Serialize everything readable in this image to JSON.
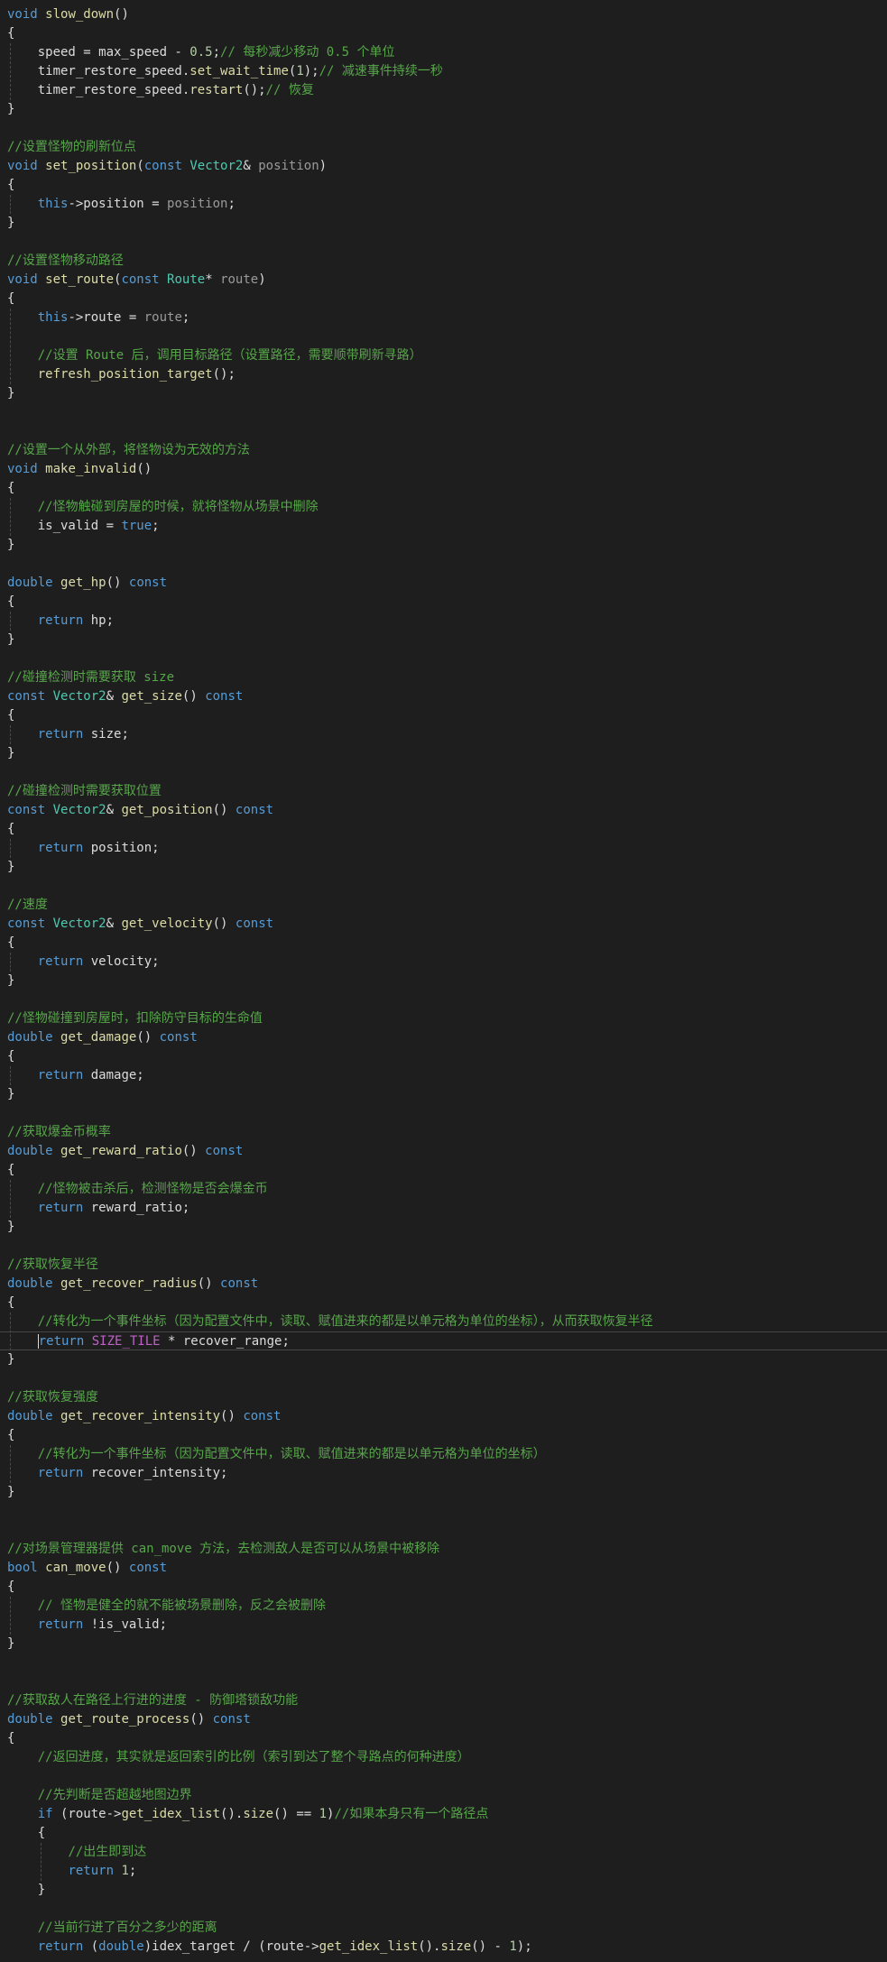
{
  "colors": {
    "background": "#1e1e1e",
    "plain": "#dcdcdc",
    "keyword": "#569cd6",
    "type": "#4ec9b0",
    "function": "#dcdcaa",
    "comment": "#57a64a",
    "number": "#b5cea8",
    "macro": "#bd63c5",
    "parameter": "#9a9a9a"
  },
  "code_lines": [
    [
      [
        "kw",
        "void"
      ],
      [
        "pl",
        " "
      ],
      [
        "fn",
        "slow_down"
      ],
      [
        "pl",
        "()"
      ]
    ],
    [
      [
        "pl",
        "{"
      ]
    ],
    [
      [
        "pl",
        "    speed = max_speed - "
      ],
      [
        "num",
        "0.5"
      ],
      [
        "pl",
        ";"
      ],
      [
        "cm",
        "// 每秒减少移动 0.5 个单位"
      ]
    ],
    [
      [
        "pl",
        "    timer_restore_speed."
      ],
      [
        "fn",
        "set_wait_time"
      ],
      [
        "pl",
        "("
      ],
      [
        "num",
        "1"
      ],
      [
        "pl",
        ");"
      ],
      [
        "cm",
        "// 减速事件持续一秒"
      ]
    ],
    [
      [
        "pl",
        "    timer_restore_speed."
      ],
      [
        "fn",
        "restart"
      ],
      [
        "pl",
        "();"
      ],
      [
        "cm",
        "// 恢复"
      ]
    ],
    [
      [
        "pl",
        "}"
      ]
    ],
    [],
    [
      [
        "cm",
        "//设置怪物的刷新位点"
      ]
    ],
    [
      [
        "kw",
        "void"
      ],
      [
        "pl",
        " "
      ],
      [
        "fn",
        "set_position"
      ],
      [
        "pl",
        "("
      ],
      [
        "kw",
        "const"
      ],
      [
        "pl",
        " "
      ],
      [
        "ty",
        "Vector2"
      ],
      [
        "pl",
        "& "
      ],
      [
        "par",
        "position"
      ],
      [
        "pl",
        ")"
      ]
    ],
    [
      [
        "pl",
        "{"
      ]
    ],
    [
      [
        "pl",
        "    "
      ],
      [
        "kw",
        "this"
      ],
      [
        "pl",
        "->position = "
      ],
      [
        "par",
        "position"
      ],
      [
        "pl",
        ";"
      ]
    ],
    [
      [
        "pl",
        "}"
      ]
    ],
    [],
    [
      [
        "cm",
        "//设置怪物移动路径"
      ]
    ],
    [
      [
        "kw",
        "void"
      ],
      [
        "pl",
        " "
      ],
      [
        "fn",
        "set_route"
      ],
      [
        "pl",
        "("
      ],
      [
        "kw",
        "const"
      ],
      [
        "pl",
        " "
      ],
      [
        "ty",
        "Route"
      ],
      [
        "pl",
        "* "
      ],
      [
        "par",
        "route"
      ],
      [
        "pl",
        ")"
      ]
    ],
    [
      [
        "pl",
        "{"
      ]
    ],
    [
      [
        "pl",
        "    "
      ],
      [
        "kw",
        "this"
      ],
      [
        "pl",
        "->route = "
      ],
      [
        "par",
        "route"
      ],
      [
        "pl",
        ";"
      ]
    ],
    [],
    [
      [
        "pl",
        "    "
      ],
      [
        "cm",
        "//设置 Route 后，调用目标路径（设置路径，需要顺带刷新寻路）"
      ]
    ],
    [
      [
        "pl",
        "    "
      ],
      [
        "fn",
        "refresh_position_target"
      ],
      [
        "pl",
        "();"
      ]
    ],
    [
      [
        "pl",
        "}"
      ]
    ],
    [],
    [],
    [
      [
        "cm",
        "//设置一个从外部，将怪物设为无效的方法"
      ]
    ],
    [
      [
        "kw",
        "void"
      ],
      [
        "pl",
        " "
      ],
      [
        "fn",
        "make_invalid"
      ],
      [
        "pl",
        "()"
      ]
    ],
    [
      [
        "pl",
        "{"
      ]
    ],
    [
      [
        "pl",
        "    "
      ],
      [
        "cm",
        "//怪物触碰到房屋的时候，就将怪物从场景中删除"
      ]
    ],
    [
      [
        "pl",
        "    is_valid = "
      ],
      [
        "kw",
        "true"
      ],
      [
        "pl",
        ";"
      ]
    ],
    [
      [
        "pl",
        "}"
      ]
    ],
    [],
    [
      [
        "kw",
        "double"
      ],
      [
        "pl",
        " "
      ],
      [
        "fn",
        "get_hp"
      ],
      [
        "pl",
        "() "
      ],
      [
        "kw",
        "const"
      ]
    ],
    [
      [
        "pl",
        "{"
      ]
    ],
    [
      [
        "pl",
        "    "
      ],
      [
        "kw",
        "return"
      ],
      [
        "pl",
        " hp;"
      ]
    ],
    [
      [
        "pl",
        "}"
      ]
    ],
    [],
    [
      [
        "cm",
        "//碰撞检测时需要获取 size"
      ]
    ],
    [
      [
        "kw",
        "const"
      ],
      [
        "pl",
        " "
      ],
      [
        "ty",
        "Vector2"
      ],
      [
        "pl",
        "& "
      ],
      [
        "fn",
        "get_size"
      ],
      [
        "pl",
        "() "
      ],
      [
        "kw",
        "const"
      ]
    ],
    [
      [
        "pl",
        "{"
      ]
    ],
    [
      [
        "pl",
        "    "
      ],
      [
        "kw",
        "return"
      ],
      [
        "pl",
        " size;"
      ]
    ],
    [
      [
        "pl",
        "}"
      ]
    ],
    [],
    [
      [
        "cm",
        "//碰撞检测时需要获取位置"
      ]
    ],
    [
      [
        "kw",
        "const"
      ],
      [
        "pl",
        " "
      ],
      [
        "ty",
        "Vector2"
      ],
      [
        "pl",
        "& "
      ],
      [
        "fn",
        "get_position"
      ],
      [
        "pl",
        "() "
      ],
      [
        "kw",
        "const"
      ]
    ],
    [
      [
        "pl",
        "{"
      ]
    ],
    [
      [
        "pl",
        "    "
      ],
      [
        "kw",
        "return"
      ],
      [
        "pl",
        " position;"
      ]
    ],
    [
      [
        "pl",
        "}"
      ]
    ],
    [],
    [
      [
        "cm",
        "//速度"
      ]
    ],
    [
      [
        "kw",
        "const"
      ],
      [
        "pl",
        " "
      ],
      [
        "ty",
        "Vector2"
      ],
      [
        "pl",
        "& "
      ],
      [
        "fn",
        "get_velocity"
      ],
      [
        "pl",
        "() "
      ],
      [
        "kw",
        "const"
      ]
    ],
    [
      [
        "pl",
        "{"
      ]
    ],
    [
      [
        "pl",
        "    "
      ],
      [
        "kw",
        "return"
      ],
      [
        "pl",
        " velocity;"
      ]
    ],
    [
      [
        "pl",
        "}"
      ]
    ],
    [],
    [
      [
        "cm",
        "//怪物碰撞到房屋时，扣除防守目标的生命值"
      ]
    ],
    [
      [
        "kw",
        "double"
      ],
      [
        "pl",
        " "
      ],
      [
        "fn",
        "get_damage"
      ],
      [
        "pl",
        "() "
      ],
      [
        "kw",
        "const"
      ]
    ],
    [
      [
        "pl",
        "{"
      ]
    ],
    [
      [
        "pl",
        "    "
      ],
      [
        "kw",
        "return"
      ],
      [
        "pl",
        " damage;"
      ]
    ],
    [
      [
        "pl",
        "}"
      ]
    ],
    [],
    [
      [
        "cm",
        "//获取爆金币概率"
      ]
    ],
    [
      [
        "kw",
        "double"
      ],
      [
        "pl",
        " "
      ],
      [
        "fn",
        "get_reward_ratio"
      ],
      [
        "pl",
        "() "
      ],
      [
        "kw",
        "const"
      ]
    ],
    [
      [
        "pl",
        "{"
      ]
    ],
    [
      [
        "pl",
        "    "
      ],
      [
        "cm",
        "//怪物被击杀后，检测怪物是否会爆金币"
      ]
    ],
    [
      [
        "pl",
        "    "
      ],
      [
        "kw",
        "return"
      ],
      [
        "pl",
        " reward_ratio;"
      ]
    ],
    [
      [
        "pl",
        "}"
      ]
    ],
    [],
    [
      [
        "cm",
        "//获取恢复半径"
      ]
    ],
    [
      [
        "kw",
        "double"
      ],
      [
        "pl",
        " "
      ],
      [
        "fn",
        "get_recover_radius"
      ],
      [
        "pl",
        "() "
      ],
      [
        "kw",
        "const"
      ]
    ],
    [
      [
        "pl",
        "{"
      ]
    ],
    [
      [
        "pl",
        "    "
      ],
      [
        "cm",
        "//转化为一个事件坐标（因为配置文件中，读取、赋值进来的都是以单元格为单位的坐标），从而获取恢复半径"
      ]
    ],
    [
      [
        "pl",
        "    "
      ],
      [
        "kw",
        "return"
      ],
      [
        "pl",
        " "
      ],
      [
        "mac",
        "SIZE_TILE"
      ],
      [
        "pl",
        " * recover_range;"
      ]
    ],
    [
      [
        "pl",
        "}"
      ]
    ],
    [],
    [
      [
        "cm",
        "//获取恢复强度"
      ]
    ],
    [
      [
        "kw",
        "double"
      ],
      [
        "pl",
        " "
      ],
      [
        "fn",
        "get_recover_intensity"
      ],
      [
        "pl",
        "() "
      ],
      [
        "kw",
        "const"
      ]
    ],
    [
      [
        "pl",
        "{"
      ]
    ],
    [
      [
        "pl",
        "    "
      ],
      [
        "cm",
        "//转化为一个事件坐标（因为配置文件中，读取、赋值进来的都是以单元格为单位的坐标）"
      ]
    ],
    [
      [
        "pl",
        "    "
      ],
      [
        "kw",
        "return"
      ],
      [
        "pl",
        " recover_intensity;"
      ]
    ],
    [
      [
        "pl",
        "}"
      ]
    ],
    [],
    [],
    [
      [
        "cm",
        "//对场景管理器提供 can_move 方法，去检测敌人是否可以从场景中被移除"
      ]
    ],
    [
      [
        "kw",
        "bool"
      ],
      [
        "pl",
        " "
      ],
      [
        "fn",
        "can_move"
      ],
      [
        "pl",
        "() "
      ],
      [
        "kw",
        "const"
      ]
    ],
    [
      [
        "pl",
        "{"
      ]
    ],
    [
      [
        "pl",
        "    "
      ],
      [
        "cm",
        "// 怪物是健全的就不能被场景删除，反之会被删除"
      ]
    ],
    [
      [
        "pl",
        "    "
      ],
      [
        "kw",
        "return"
      ],
      [
        "pl",
        " !is_valid;"
      ]
    ],
    [
      [
        "pl",
        "}"
      ]
    ],
    [],
    [],
    [
      [
        "cm",
        "//获取敌人在路径上行进的进度 - 防御塔锁敌功能"
      ]
    ],
    [
      [
        "kw",
        "double"
      ],
      [
        "pl",
        " "
      ],
      [
        "fn",
        "get_route_process"
      ],
      [
        "pl",
        "() "
      ],
      [
        "kw",
        "const"
      ]
    ],
    [
      [
        "pl",
        "{"
      ]
    ],
    [
      [
        "pl",
        "    "
      ],
      [
        "cm",
        "//返回进度，其实就是返回索引的比例（索引到达了整个寻路点的何种进度）"
      ]
    ],
    [],
    [
      [
        "pl",
        "    "
      ],
      [
        "cm",
        "//先判断是否超越地图边界"
      ]
    ],
    [
      [
        "pl",
        "    "
      ],
      [
        "kw",
        "if"
      ],
      [
        "pl",
        " (route->"
      ],
      [
        "fn",
        "get_idex_list"
      ],
      [
        "pl",
        "()."
      ],
      [
        "fn",
        "size"
      ],
      [
        "pl",
        "() == "
      ],
      [
        "num",
        "1"
      ],
      [
        "pl",
        ")"
      ],
      [
        "cm",
        "//如果本身只有一个路径点"
      ]
    ],
    [
      [
        "pl",
        "    {"
      ]
    ],
    [
      [
        "pl",
        "        "
      ],
      [
        "cm",
        "//出生即到达"
      ]
    ],
    [
      [
        "pl",
        "        "
      ],
      [
        "kw",
        "return"
      ],
      [
        "pl",
        " "
      ],
      [
        "num",
        "1"
      ],
      [
        "pl",
        ";"
      ]
    ],
    [
      [
        "pl",
        "    }"
      ]
    ],
    [],
    [
      [
        "pl",
        "    "
      ],
      [
        "cm",
        "//当前行进了百分之多少的距离"
      ]
    ],
    [
      [
        "pl",
        "    "
      ],
      [
        "kw",
        "return"
      ],
      [
        "pl",
        " ("
      ],
      [
        "kw",
        "double"
      ],
      [
        "pl",
        ")idex_target / (route->"
      ],
      [
        "fn",
        "get_idex_list"
      ],
      [
        "pl",
        "()."
      ],
      [
        "fn",
        "size"
      ],
      [
        "pl",
        "() - "
      ],
      [
        "num",
        "1"
      ],
      [
        "pl",
        ");"
      ]
    ]
  ]
}
